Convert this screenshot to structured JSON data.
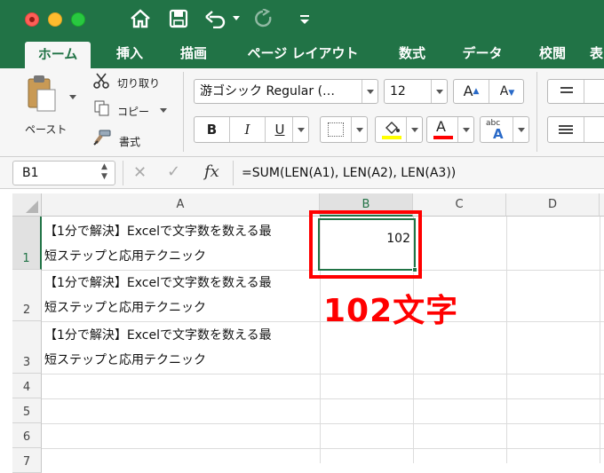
{
  "ribbon_tabs": [
    "ホーム",
    "挿入",
    "描画",
    "ページ レイアウト",
    "数式",
    "データ",
    "校閲",
    "表"
  ],
  "ribbon": {
    "paste_label": "ペースト",
    "cut_label": "切り取り",
    "copy_label": "コピー",
    "format_painter_label": "書式",
    "font_name": "游ゴシック Regular (…",
    "font_size": "12",
    "bold": "B",
    "italic": "I",
    "underline": "U",
    "grow_font": "A",
    "shrink_font": "A",
    "font_color_glyph": "A",
    "phonetic_abc": "abc",
    "phonetic_a": "A"
  },
  "formula_bar": {
    "name_box": "B1",
    "fx": "fx",
    "formula": "=SUM(LEN(A1), LEN(A2), LEN(A3))"
  },
  "grid": {
    "columns": [
      "A",
      "B",
      "C",
      "D"
    ],
    "rows": [
      "1",
      "2",
      "3",
      "4",
      "5",
      "6",
      "7"
    ],
    "a1_line1": "【1分で解決】Excelで文字数を数える最",
    "a1_line2": "短ステップと応用テクニック",
    "a2_line1": "【1分で解決】Excelで文字数を数える最",
    "a2_line2": "短ステップと応用テクニック",
    "a3_line1": "【1分で解決】Excelで文字数を数える最",
    "a3_line2": "短ステップと応用テクニック",
    "b1_value": "102"
  },
  "annotation": "102文字",
  "colors": {
    "excel_green": "#217346",
    "annotation_red": "#ff0000",
    "fill_yellow": "#ffff00",
    "font_red": "#ff0000"
  }
}
